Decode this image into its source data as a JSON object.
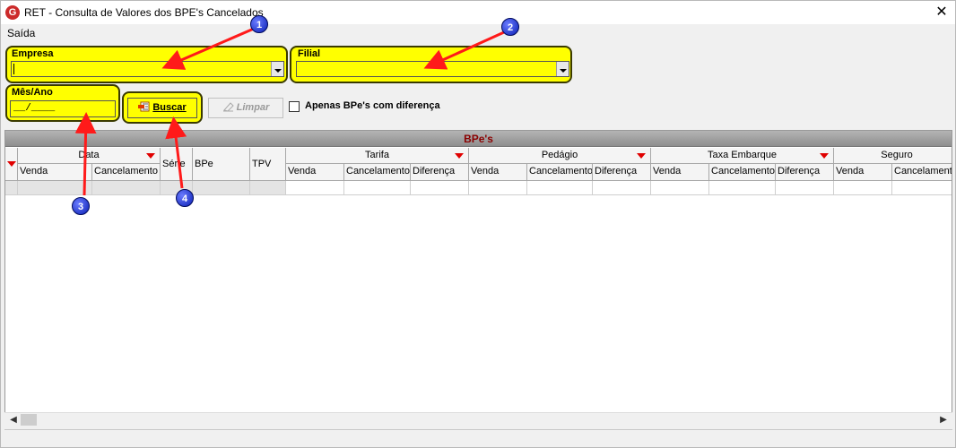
{
  "window": {
    "title": "RET - Consulta de Valores dos BPE's Cancelados",
    "app_icon_letter": "G",
    "close_glyph": "✕"
  },
  "menu": {
    "items": [
      "Saída"
    ]
  },
  "form": {
    "empresa_label": "Empresa",
    "filial_label": "Filial",
    "mes_ano_label": "Mês/Ano",
    "mes_ano_value": "__/____",
    "buscar_label": "Buscar",
    "limpar_label": "Limpar",
    "checkbox_label": "Apenas BPe's com diferença",
    "checkbox_checked": false
  },
  "grid": {
    "title": "BPe's",
    "group_headers": {
      "data": "Data",
      "serie": "Série",
      "bpe": "BPe",
      "tpv": "TPV",
      "tarifa": "Tarifa",
      "pedagio": "Pedágio",
      "taxa_embarque": "Taxa Embarque",
      "seguro": "Seguro"
    },
    "sub_headers": {
      "venda": "Venda",
      "cancelamento": "Cancelamento",
      "diferenca": "Diferença"
    }
  },
  "annotations": {
    "markers": [
      "1",
      "2",
      "3",
      "4"
    ]
  },
  "colors": {
    "highlight": "#ffff00",
    "marker_blue": "#0a1fb4",
    "arrow_red": "#ff1a1a",
    "grid_title": "#8a0000",
    "sort_mark": "#e00000"
  }
}
